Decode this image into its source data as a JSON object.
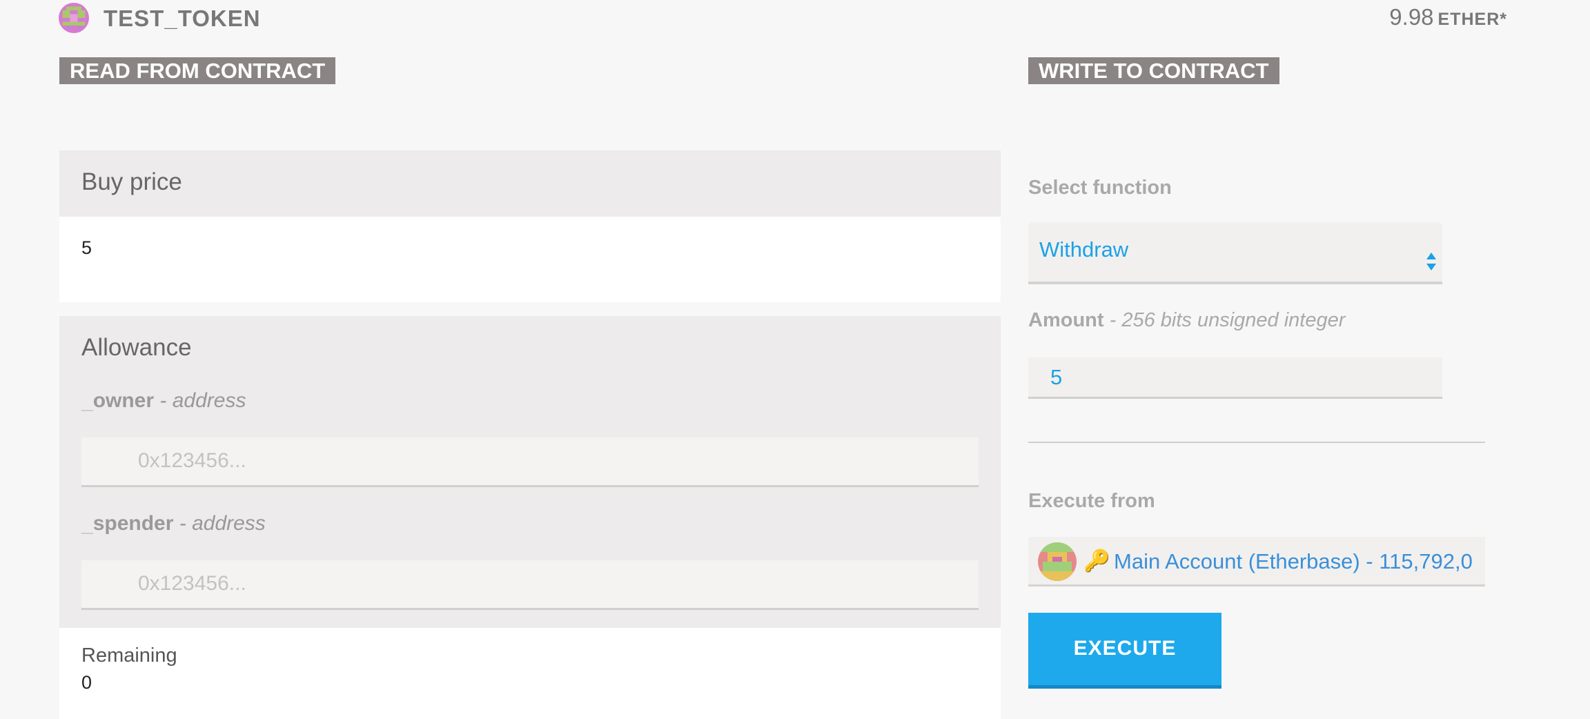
{
  "header": {
    "token_name": "TEST_TOKEN",
    "balance_value": "9.98",
    "balance_unit": "ETHER*"
  },
  "read": {
    "section_label": "READ FROM CONTRACT",
    "buy_price": {
      "title": "Buy price",
      "value": "5"
    },
    "allowance": {
      "title": "Allowance",
      "owner": {
        "underscore": "_",
        "name": "owner",
        "sep": " - ",
        "type": "address",
        "placeholder": "0x123456..."
      },
      "spender": {
        "underscore": "_",
        "name": "spender",
        "sep": " - ",
        "type": "address",
        "placeholder": "0x123456..."
      },
      "result_label": "Remaining",
      "result_value": "0"
    }
  },
  "write": {
    "section_label": "WRITE TO CONTRACT",
    "select_label": "Select function",
    "selected_function": "Withdraw",
    "amount": {
      "name": "Amount",
      "sep": " - ",
      "type": "256 bits unsigned integer",
      "value": "5"
    },
    "execute_from_label": "Execute from",
    "account_key_icon": "🔑",
    "account_text": "Main Account (Etherbase) - 115,792,0",
    "execute_label": "EXECUTE"
  },
  "colors": {
    "accent": "#1da1e6",
    "button": "#1ea9ec",
    "section_label_bg": "#8a8584",
    "account_link": "#3a8fd8"
  },
  "icons": [
    "token-identicon-icon",
    "select-arrows-icon",
    "account-identicon-icon",
    "key-icon"
  ]
}
